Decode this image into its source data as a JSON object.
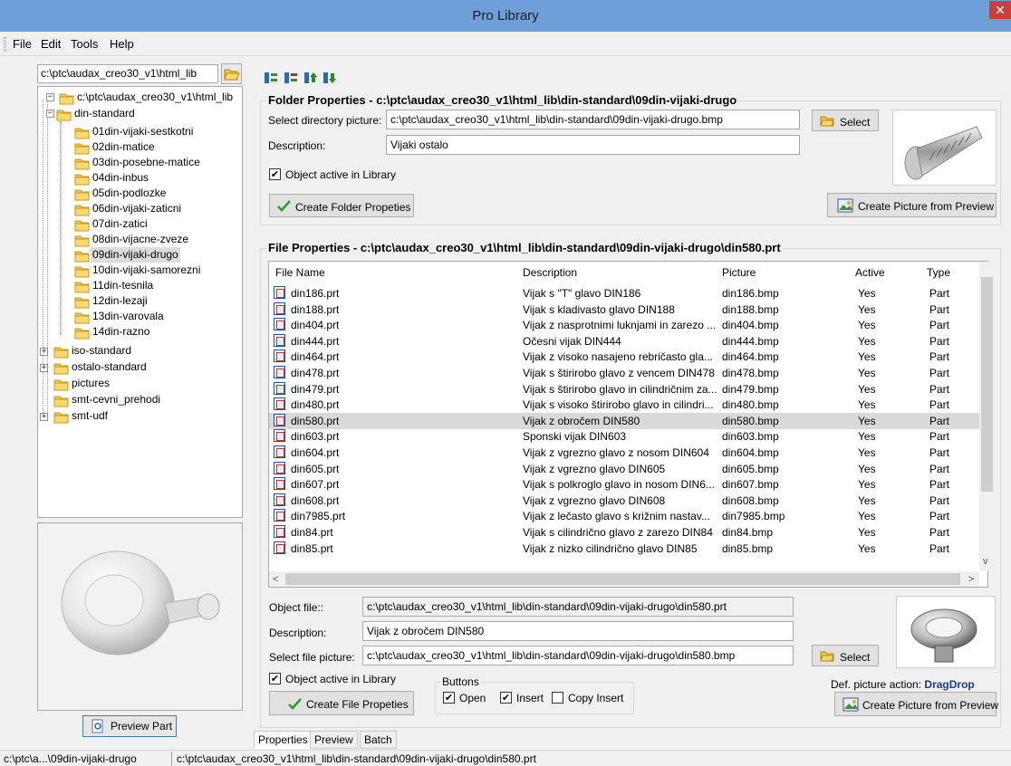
{
  "window": {
    "title": "Pro Library",
    "close_glyph": "✕"
  },
  "menu": {
    "items": [
      "File",
      "Edit",
      "Tools",
      "Help"
    ]
  },
  "left": {
    "path_value": "c:\\ptc\\audax_creo30_v1\\html_lib",
    "tree": {
      "root": "c:\\ptc\\audax_creo30_v1\\html_lib",
      "din_standard": "din-standard",
      "children": [
        "01din-vijaki-sestkotni",
        "02din-matice",
        "03din-posebne-matice",
        "04din-inbus",
        "05din-podlozke",
        "06din-vijaki-zaticni",
        "07din-zatici",
        "08din-vijacne-zveze",
        "09din-vijaki-drugo",
        "10din-vijaki-samorezni",
        "11din-tesnila",
        "12din-lezaji",
        "13din-varovala",
        "14din-razno"
      ],
      "others": [
        "iso-standard",
        "ostalo-standard",
        "pictures",
        "smt-cevni_prehodi",
        "smt-udf"
      ]
    },
    "preview_button": "Preview Part"
  },
  "folder_props": {
    "title": "Folder Properties - c:\\ptc\\audax_creo30_v1\\html_lib\\din-standard\\09din-vijaki-drugo",
    "select_dir_label": "Select directory picture:",
    "select_dir_value": "c:\\ptc\\audax_creo30_v1\\html_lib\\din-standard\\09din-vijaki-drugo.bmp",
    "select_button": "Select",
    "description_label": "Description:",
    "description_value": "Vijaki ostalo",
    "active_label": "Object active in Library",
    "create_button": "Create Folder Propeties",
    "create_picture_button": "Create Picture from Preview"
  },
  "file_props": {
    "title": "File Properties - c:\\ptc\\audax_creo30_v1\\html_lib\\din-standard\\09din-vijaki-drugo\\din580.prt",
    "columns": [
      "File Name",
      "Description",
      "Picture",
      "Active",
      "Type"
    ],
    "rows": [
      {
        "file": "din186.prt",
        "desc": "Vijak s \"T\" glavo DIN186",
        "pic": "din186.bmp",
        "active": "Yes",
        "type": "Part"
      },
      {
        "file": "din188.prt",
        "desc": "Vijak s kladivasto glavo DIN188",
        "pic": "din188.bmp",
        "active": "Yes",
        "type": "Part"
      },
      {
        "file": "din404.prt",
        "desc": "Vijak z nasprotnimi luknjami in zarezo ...",
        "pic": "din404.bmp",
        "active": "Yes",
        "type": "Part"
      },
      {
        "file": "din444.prt",
        "desc": "Očesni vijak DIN444",
        "pic": "din444.bmp",
        "active": "Yes",
        "type": "Part"
      },
      {
        "file": "din464.prt",
        "desc": "Vijak z visoko nasajeno rebričasto gla...",
        "pic": "din464.bmp",
        "active": "Yes",
        "type": "Part"
      },
      {
        "file": "din478.prt",
        "desc": "Vijak s štirirobo glavo z vencem DIN478",
        "pic": "din478.bmp",
        "active": "Yes",
        "type": "Part"
      },
      {
        "file": "din479.prt",
        "desc": "Vijak s štirirobo glavo in cilindričnim za...",
        "pic": "din479.bmp",
        "active": "Yes",
        "type": "Part"
      },
      {
        "file": "din480.prt",
        "desc": "Vijak s visoko štirirobo glavo in cilindri...",
        "pic": "din480.bmp",
        "active": "Yes",
        "type": "Part"
      },
      {
        "file": "din580.prt",
        "desc": "Vijak z obročem DIN580",
        "pic": "din580.bmp",
        "active": "Yes",
        "type": "Part"
      },
      {
        "file": "din603.prt",
        "desc": "Sponski vijak DIN603",
        "pic": "din603.bmp",
        "active": "Yes",
        "type": "Part"
      },
      {
        "file": "din604.prt",
        "desc": "Vijak z vgrezno glavo z nosom DIN604",
        "pic": "din604.bmp",
        "active": "Yes",
        "type": "Part"
      },
      {
        "file": "din605.prt",
        "desc": "Vijak z vgrezno glavo DIN605",
        "pic": "din605.bmp",
        "active": "Yes",
        "type": "Part"
      },
      {
        "file": "din607.prt",
        "desc": "Vijak s polkroglo glavo in nosom DIN6...",
        "pic": "din607.bmp",
        "active": "Yes",
        "type": "Part"
      },
      {
        "file": "din608.prt",
        "desc": "Vijak z vgrezno glavo DIN608",
        "pic": "din608.bmp",
        "active": "Yes",
        "type": "Part"
      },
      {
        "file": "din7985.prt",
        "desc": "Vijak z lečasto glavo s križnim nastav...",
        "pic": "din7985.bmp",
        "active": "Yes",
        "type": "Part"
      },
      {
        "file": "din84.prt",
        "desc": "Vijak s cilindrično glavo z zarezo DIN84",
        "pic": "din84.bmp",
        "active": "Yes",
        "type": "Part"
      },
      {
        "file": "din85.prt",
        "desc": "Vijak z nizko cilindrično glavo DIN85",
        "pic": "din85.bmp",
        "active": "Yes",
        "type": "Part"
      }
    ],
    "object_file_label": "Object file::",
    "object_file_value": "c:\\ptc\\audax_creo30_v1\\html_lib\\din-standard\\09din-vijaki-drugo\\din580.prt",
    "description_label": "Description:",
    "description_value": "Vijak z obročem DIN580",
    "select_pic_label": "Select file picture:",
    "select_pic_value": "c:\\ptc\\audax_creo30_v1\\html_lib\\din-standard\\09din-vijaki-drugo\\din580.bmp",
    "select_button": "Select",
    "active_label": "Object active in Library",
    "buttons_group": "Buttons",
    "open_label": "Open",
    "insert_label": "Insert",
    "copy_insert_label": "Copy Insert",
    "create_button": "Create File Propeties",
    "def_action_label": "Def. picture action:",
    "def_action_value": "DragDrop",
    "create_picture_button": "Create Picture from Preview"
  },
  "tabs": [
    "Properties",
    "Preview",
    "Batch"
  ],
  "status": {
    "left": "c:\\ptc\\a...\\09din-vijaki-drugo",
    "right": "c:\\ptc\\audax_creo30_v1\\html_lib\\din-standard\\09din-vijaki-drugo\\din580.prt"
  },
  "colors": {
    "titlebar": "#6f9fd8",
    "close": "#c7403a",
    "selected_row": "#d9d9d9",
    "link_blue": "#1a3a9c",
    "folder": "#f5c542"
  }
}
